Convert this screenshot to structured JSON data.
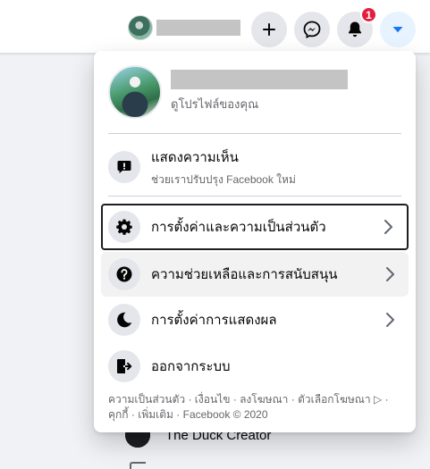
{
  "topbar": {
    "notification_count": "1",
    "icons": {
      "create": "plus-icon",
      "messenger": "messenger-icon",
      "notifications": "bell-icon",
      "account": "caret-down-icon"
    },
    "accent": "#1877f2"
  },
  "menu": {
    "profile_sub": "ดูโปรไฟล์ของคุณ",
    "feedback_title": "แสดงความเห็น",
    "feedback_sub": "ช่วยเราปรับปรุง Facebook ใหม่",
    "items": [
      {
        "label": "การตั้งค่าและความเป็นส่วนตัว",
        "icon": "gear-icon"
      },
      {
        "label": "ความช่วยเหลือและการสนับสนุน",
        "icon": "question-icon"
      },
      {
        "label": "การตั้งค่าการแสดงผล",
        "icon": "moon-icon"
      },
      {
        "label": "ออกจากระบบ",
        "icon": "logout-icon"
      }
    ],
    "footer_line1": "ความเป็นส่วนตัว · เงื่อนไข · ลงโฆษณา · ตัวเลือกโฆษณา ▷ ·",
    "footer_line2": "คุกกี้ · เพิ่มเติม · Facebook © 2020"
  },
  "background": {
    "item_label": "The Duck Creator"
  }
}
